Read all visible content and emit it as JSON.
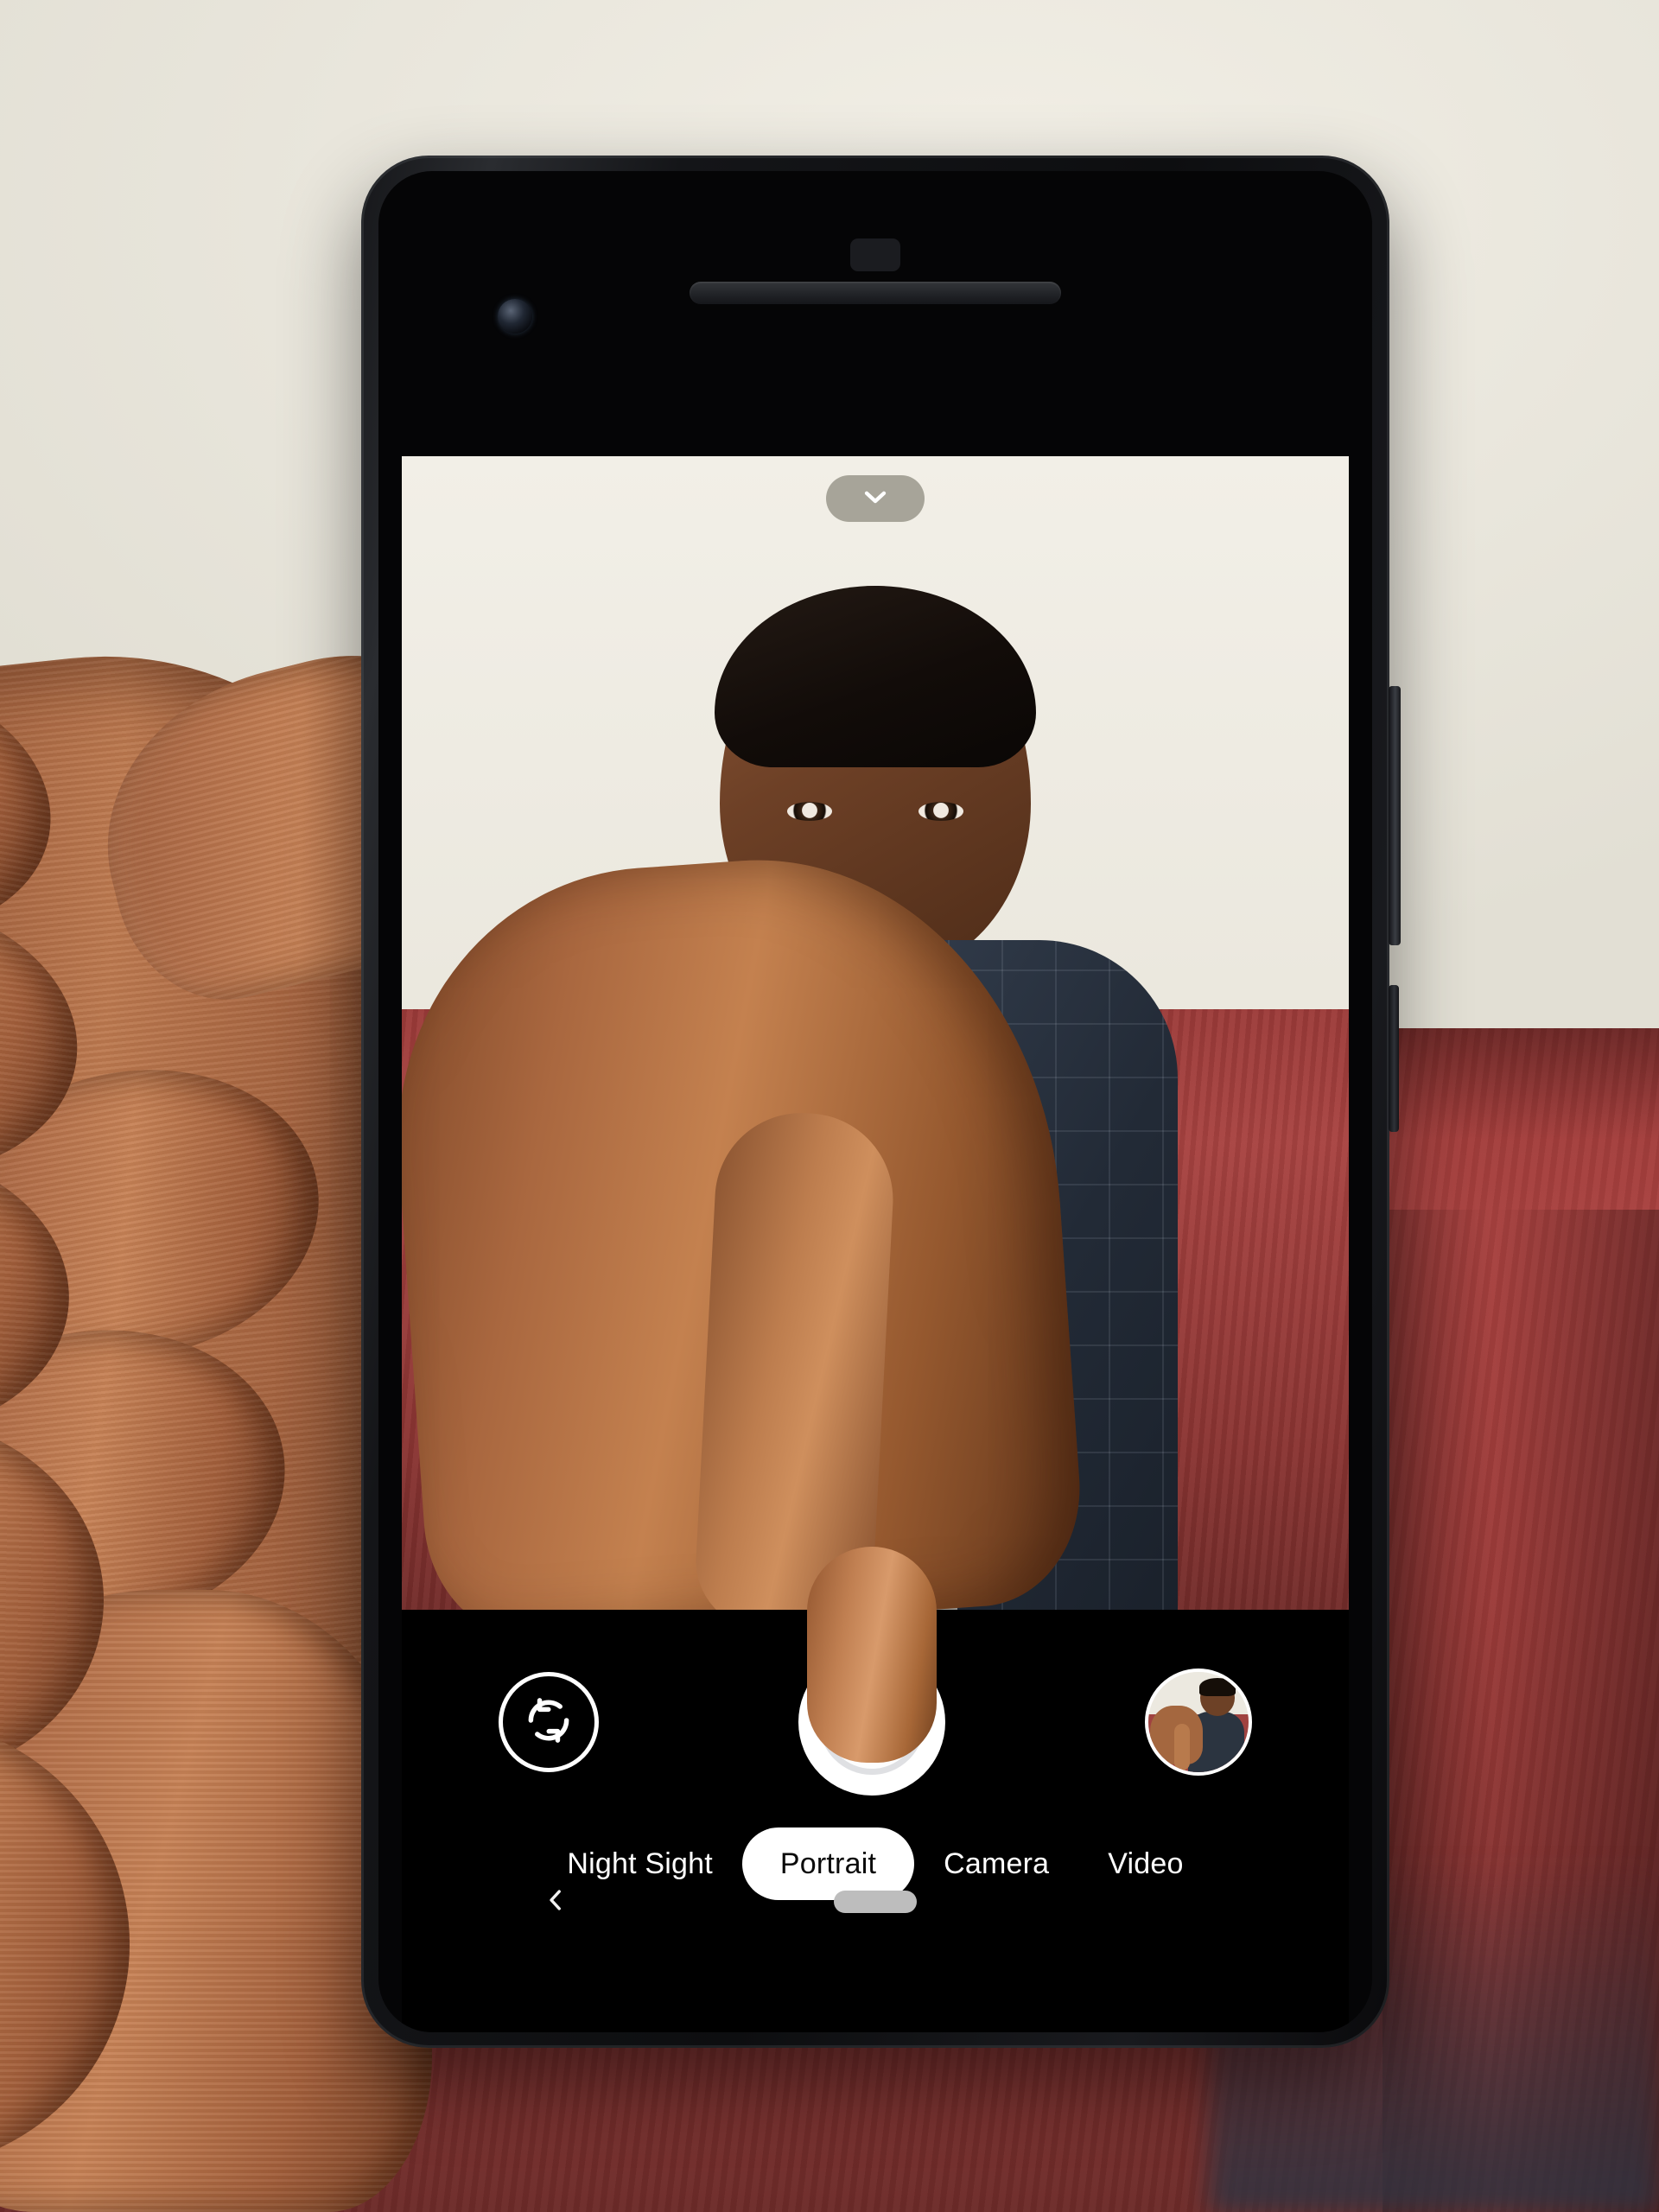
{
  "app": {
    "name": "Camera",
    "screen_title": "Portrait mode viewfinder"
  },
  "viewfinder": {
    "expand_control": {
      "icon": "chevron-down-icon",
      "label": "Expand camera settings",
      "background_color": "#96948890"
    },
    "scene_description": "Man in navy windowpane suit pointing at camera, seated on red sofa against cream wall"
  },
  "controls": {
    "flip_camera": {
      "icon": "camera-flip-icon",
      "label": "Switch camera"
    },
    "shutter": {
      "icon": "shutter-icon",
      "label": "Take photo"
    },
    "thumbnail": {
      "icon": "photo-thumbnail-icon",
      "label": "Last photo"
    }
  },
  "modes": {
    "items": [
      {
        "label": "Night Sight",
        "selected": false
      },
      {
        "label": "Portrait",
        "selected": true
      },
      {
        "label": "Camera",
        "selected": false
      },
      {
        "label": "Video",
        "selected": false
      }
    ],
    "selected_label": "Portrait"
  },
  "navbar": {
    "back": {
      "icon": "chevron-left-icon",
      "label": "Back"
    },
    "home": {
      "icon": "home-pill-icon",
      "label": "Home"
    }
  },
  "hardware": {
    "earpiece": "earpiece-speaker",
    "front_camera": "front-camera-lens",
    "bottom_speaker": "bottom-speaker",
    "power_button": "power-button",
    "volume_button": "volume-button"
  },
  "colors": {
    "background_wall": "#edeae0",
    "sofa_red": "#a8413f",
    "phone_body": "#141518",
    "controls_bar": "#000000",
    "selected_pill": "#ffffff",
    "mode_text": "#ffffff",
    "nav_home_pill": "#bdbdbd",
    "suit_navy": "#2c3440",
    "skin": "#b4714b"
  }
}
